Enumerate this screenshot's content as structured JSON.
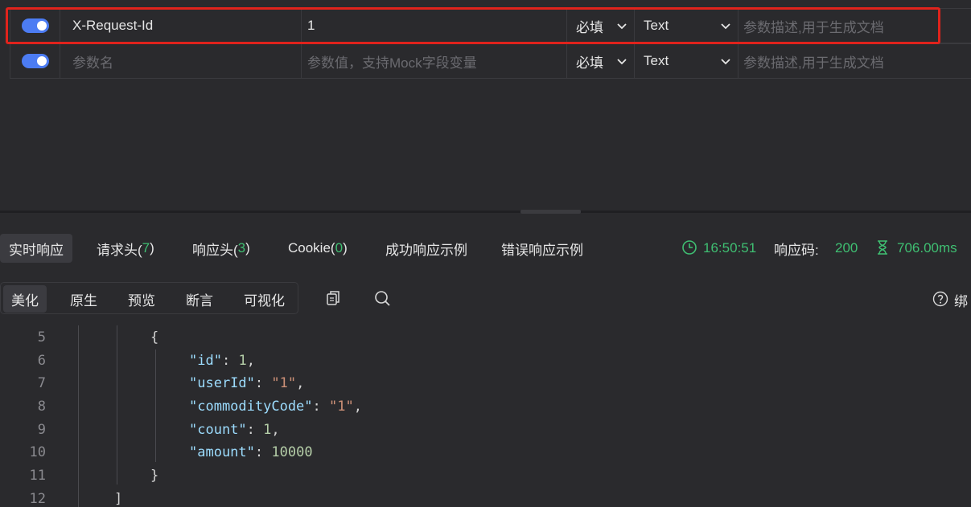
{
  "params": [
    {
      "enabled": true,
      "name": "X-Request-Id",
      "value": "1",
      "required": "必填",
      "type": "Text",
      "desc_placeholder": "参数描述,用于生成文档"
    },
    {
      "enabled": true,
      "name_placeholder": "参数名",
      "value_placeholder": "参数值，支持Mock字段变量",
      "required": "必填",
      "type": "Text",
      "desc_placeholder": "参数描述,用于生成文档"
    }
  ],
  "response_tabs": [
    {
      "label": "实时响应",
      "active": true
    },
    {
      "label": "请求头(",
      "count": "7",
      "close": ")"
    },
    {
      "label": "响应头(",
      "count": "3",
      "close": ")"
    },
    {
      "label": "Cookie(",
      "count": "0",
      "close": ")"
    },
    {
      "label": "成功响应示例"
    },
    {
      "label": "错误响应示例"
    }
  ],
  "response_meta": {
    "time": "16:50:51",
    "code_label": "响应码:",
    "code": "200",
    "duration": "706.00ms"
  },
  "view_tabs": [
    {
      "label": "美化",
      "active": true
    },
    {
      "label": "原生"
    },
    {
      "label": "预览"
    },
    {
      "label": "断言"
    },
    {
      "label": "可视化"
    }
  ],
  "right_action": {
    "label": "绑"
  },
  "code_lines": [
    {
      "no": "5"
    },
    {
      "no": "6"
    },
    {
      "no": "7"
    },
    {
      "no": "8"
    },
    {
      "no": "9"
    },
    {
      "no": "10"
    },
    {
      "no": "11"
    },
    {
      "no": "12"
    }
  ],
  "code_tokens": {
    "open_brace": "{",
    "close_brace": "}",
    "close_bracket": "]",
    "id_key": "\"id\"",
    "id_val": "1",
    "userId_key": "\"userId\"",
    "userId_val": "\"1\"",
    "commodityCode_key": "\"commodityCode\"",
    "commodityCode_val": "\"1\"",
    "count_key": "\"count\"",
    "count_val": "1",
    "amount_key": "\"amount\"",
    "amount_val": "10000",
    "colon": ": ",
    "comma": ","
  },
  "colors": {
    "accent": "#4c7cf3",
    "success": "#3fbf72",
    "highlight": "#e0231c"
  }
}
